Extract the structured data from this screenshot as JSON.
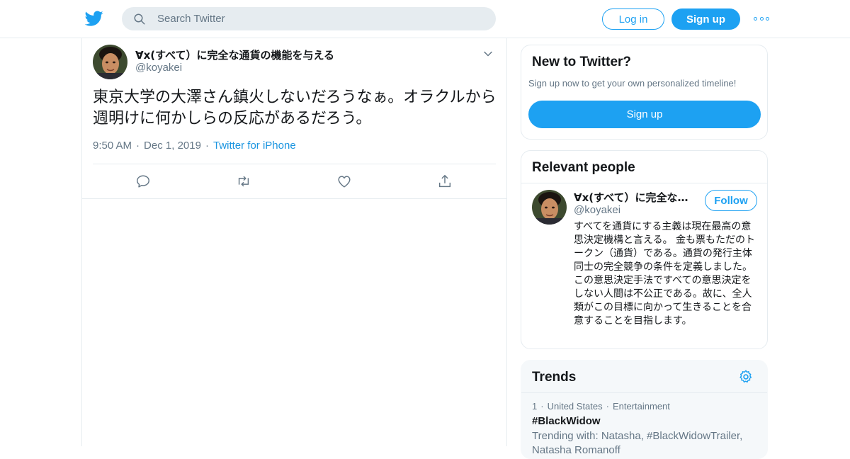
{
  "colors": {
    "accent": "#1da1f2",
    "muted": "#657786",
    "text": "#14171a",
    "border": "#e6ecf0",
    "trends_bg": "#f5f8fa"
  },
  "header": {
    "logo_icon": "twitter-bird-icon",
    "search_placeholder": "Search Twitter",
    "login_label": "Log in",
    "signup_label": "Sign up",
    "more_icon": "more-dots-icon"
  },
  "tweet": {
    "author_name": "∀x(すべて）に完全な通貨の機能を与える",
    "author_handle": "@koyakei",
    "text": "東京大学の大澤さん鎮火しないだろうなぁ。オラクルから週明けに何かしらの反応があるだろう。",
    "time": "9:50 AM",
    "date": "Dec 1, 2019",
    "source": "Twitter for iPhone",
    "separator": "·",
    "actions": [
      "reply-icon",
      "retweet-icon",
      "like-icon",
      "share-icon"
    ]
  },
  "new_to_twitter": {
    "title": "New to Twitter?",
    "description": "Sign up now to get your own personalized timeline!",
    "signup_label": "Sign up"
  },
  "relevant_people": {
    "title": "Relevant people",
    "person": {
      "name": "∀x(すべて）に完全な通…",
      "handle": "@koyakei",
      "follow_label": "Follow",
      "bio": "すべてを通貨にする主義は現在最高の意思決定機構と言える。 金も票もただのトークン（通貨）である。通貨の発行主体同士の完全競争の条件を定義しました。この意思決定手法ですべての意思決定をしない人間は不公正である。故に、全人類がこの目標に向かって生きることを合意することを目指します。"
    }
  },
  "trends": {
    "title": "Trends",
    "settings_icon": "gear-icon",
    "items": [
      {
        "rank": "1",
        "location": "United States",
        "category": "Entertainment",
        "separator": "·",
        "name": "#BlackWidow",
        "trending_with": "Trending with: Natasha, #BlackWidowTrailer, Natasha Romanoff"
      }
    ]
  }
}
